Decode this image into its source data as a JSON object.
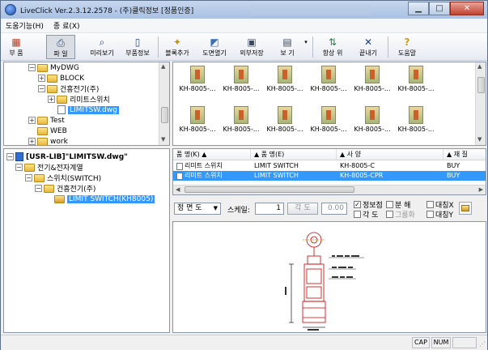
{
  "window": {
    "title": "LiveClick Ver.2.3.12.2578 - (주)클릭정보 [정품인증]",
    "minimize": "▁",
    "maximize": "□",
    "close": "✕"
  },
  "menu": [
    "도움기능(H)",
    "종 료(X)"
  ],
  "toolbar": [
    {
      "label": "부 품",
      "icon": "component-icon",
      "glyph": "▦"
    },
    {
      "label": "파 일",
      "icon": "print-icon",
      "glyph": "⎙"
    },
    {
      "label": "미리보기",
      "icon": "search-icon",
      "glyph": "⌕"
    },
    {
      "label": "부품정보",
      "icon": "document-icon",
      "glyph": "▯"
    },
    {
      "label": "블록추가",
      "icon": "block-add-icon",
      "glyph": "✦"
    },
    {
      "label": "도면열기",
      "icon": "drawing-open-icon",
      "glyph": "◩"
    },
    {
      "label": "외부저장",
      "icon": "export-icon",
      "glyph": "▣"
    },
    {
      "label": "보 기",
      "icon": "view-icon",
      "glyph": "▤"
    },
    {
      "label": "항상 위",
      "icon": "always-on-top-icon",
      "glyph": "⇅"
    },
    {
      "label": "끝내기",
      "icon": "exit-icon",
      "glyph": "✕"
    },
    {
      "label": "도움말",
      "icon": "help-icon",
      "glyph": "?"
    }
  ],
  "folder_tree": [
    {
      "label": "MyDWG",
      "expanded": true
    },
    {
      "label": "BLOCK",
      "expanded": false
    },
    {
      "label": "건흥전기(주)",
      "expanded": true
    },
    {
      "label": "리미트스위치",
      "expanded": false
    },
    {
      "label": "LIMITSW.dwg",
      "selected": true
    },
    {
      "label": "Test",
      "expanded": false
    },
    {
      "label": "WEB",
      "expanded": false
    },
    {
      "label": "work",
      "expanded": false
    }
  ],
  "thumbnails": [
    "KH-8005-...",
    "KH-8005-...",
    "KH-8005-...",
    "KH-8005-...",
    "KH-8005-...",
    "KH-8005-...",
    "KH-8005-...",
    "KH-8005-...",
    "KH-8005-...",
    "KH-8005-...",
    "KH-8005-...",
    "KH-8005-..."
  ],
  "lib_tree": {
    "root": "[USR-LIB]\"LIMITSW.dwg\"",
    "items": [
      "전기&전자계열",
      "스위치(SWITCH)",
      "건흥전기(주)",
      "LIMIT SWITCH(KH8005)"
    ]
  },
  "parts_table": {
    "columns": [
      "품 명(K) ▲",
      "▲ 품 명(E)",
      "▲ 사 양",
      "▲ 재 질"
    ],
    "rows": [
      {
        "name_k": "리미트 스위치",
        "name_e": "LIMIT SWITCH",
        "spec": "KH-8005-C",
        "material": "BUY",
        "selected": false
      },
      {
        "name_k": "리미트 스위치",
        "name_e": "LIMIT SWITCH",
        "spec": "KH-8005-CPR",
        "material": "BUY",
        "selected": true
      }
    ]
  },
  "view_options": {
    "view_select": "정 면 도",
    "scale_label": "스케일:",
    "scale_value": "1",
    "angle_button": "각 도",
    "angle_value": "0.00",
    "checks": [
      {
        "label": "정보점",
        "checked": true
      },
      {
        "label": "각 도",
        "checked": false
      },
      {
        "label": "분 해",
        "checked": false
      },
      {
        "label": "그룹화",
        "checked": false
      },
      {
        "label": "대칭X",
        "checked": false
      },
      {
        "label": "대칭Y",
        "checked": false
      }
    ]
  },
  "status": {
    "cap": "CAP",
    "num": "NUM"
  }
}
